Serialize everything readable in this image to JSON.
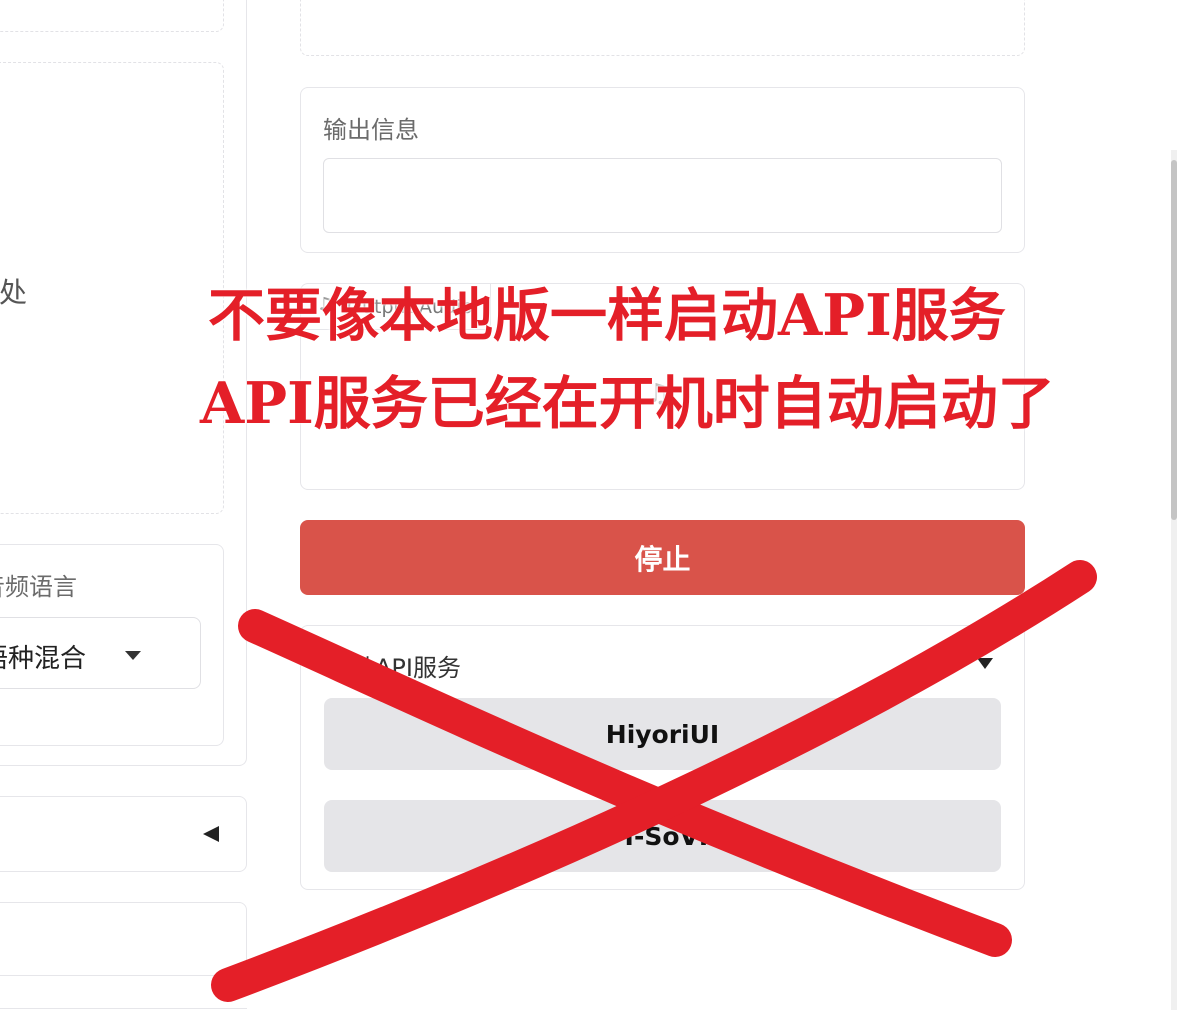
{
  "left": {
    "partial_text_1": "处",
    "language_label": "音频语言",
    "language_value": "语种混合",
    "collapse_icon": "caret-left-icon"
  },
  "right": {
    "output_info_label": "输出信息",
    "output_info_value": "",
    "output_audio_label": "Output Audio",
    "stop_button": "停止",
    "api_section_label": "动API服务",
    "hiyori_button": "HiyoriUI",
    "sovits_button": "GPT-SoVITS"
  },
  "overlay": {
    "line1": "不要像本地版一样启动API服务",
    "line2": "API服务已经在开机时自动启动了",
    "color": "#e41f28"
  },
  "colors": {
    "stop_button_bg": "#d9534a",
    "gray_button_bg": "#e5e5e8"
  }
}
